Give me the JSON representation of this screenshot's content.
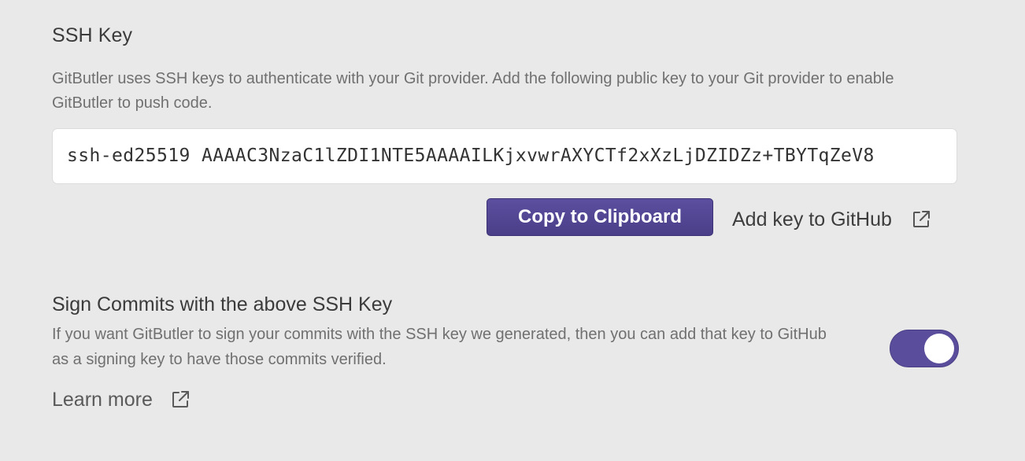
{
  "ssh_section": {
    "title": "SSH Key",
    "description": "GitButler uses SSH keys to authenticate with your Git provider. Add the following public key to your Git provider to enable GitButler to push code.",
    "public_key": "ssh-ed25519 AAAAC3NzaC1lZDI1NTE5AAAAILKjxvwrAXYCTf2xXzLjDZIDZz+TBYTqZeV8",
    "copy_button_label": "Copy to Clipboard",
    "add_key_link_label": "Add key to GitHub",
    "add_key_link_icon": "external-link-icon"
  },
  "sign_section": {
    "title": "Sign Commits with the above SSH Key",
    "description": "If you want GitButler to sign your commits with the SSH key we generated, then you can add that key to GitHub as a signing key to have those commits verified.",
    "toggle_on": true,
    "learn_more_label": "Learn more",
    "learn_more_icon": "external-link-icon"
  },
  "colors": {
    "accent": "#4f4392",
    "background": "#e9e9e9",
    "key_box_background": "#ffffff"
  }
}
